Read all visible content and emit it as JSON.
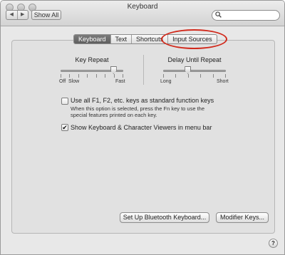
{
  "window": {
    "title": "Keyboard"
  },
  "toolbar": {
    "back_glyph": "◀",
    "forward_glyph": "▶",
    "show_all_label": "Show All",
    "search_placeholder": "",
    "search_glyph": "🔍"
  },
  "tabs": [
    {
      "label": "Keyboard",
      "selected": true
    },
    {
      "label": "Text",
      "selected": false
    },
    {
      "label": "Shortcuts",
      "selected": false
    },
    {
      "label": "Input Sources",
      "selected": false
    }
  ],
  "annotation": {
    "target": "Input Sources",
    "color": "#d12a1c"
  },
  "key_repeat": {
    "title": "Key Repeat",
    "min_labels": [
      "Off",
      "Slow"
    ],
    "max_label": "Fast",
    "level": 0.85
  },
  "delay_until_repeat": {
    "title": "Delay Until Repeat",
    "min_label": "Long",
    "max_label": "Short",
    "level": 0.4
  },
  "options": {
    "function_keys": {
      "checked": false,
      "label": "Use all F1, F2, etc. keys as standard function keys",
      "help": "When this option is selected, press the Fn key to use the special features printed on each key."
    },
    "viewers": {
      "checked": true,
      "label": "Show Keyboard & Character Viewers in menu bar"
    }
  },
  "buttons": {
    "bluetooth_label": "Set Up Bluetooth Keyboard...",
    "modifier_label": "Modifier Keys...",
    "help_label": "?"
  },
  "check_glyph": "✔"
}
